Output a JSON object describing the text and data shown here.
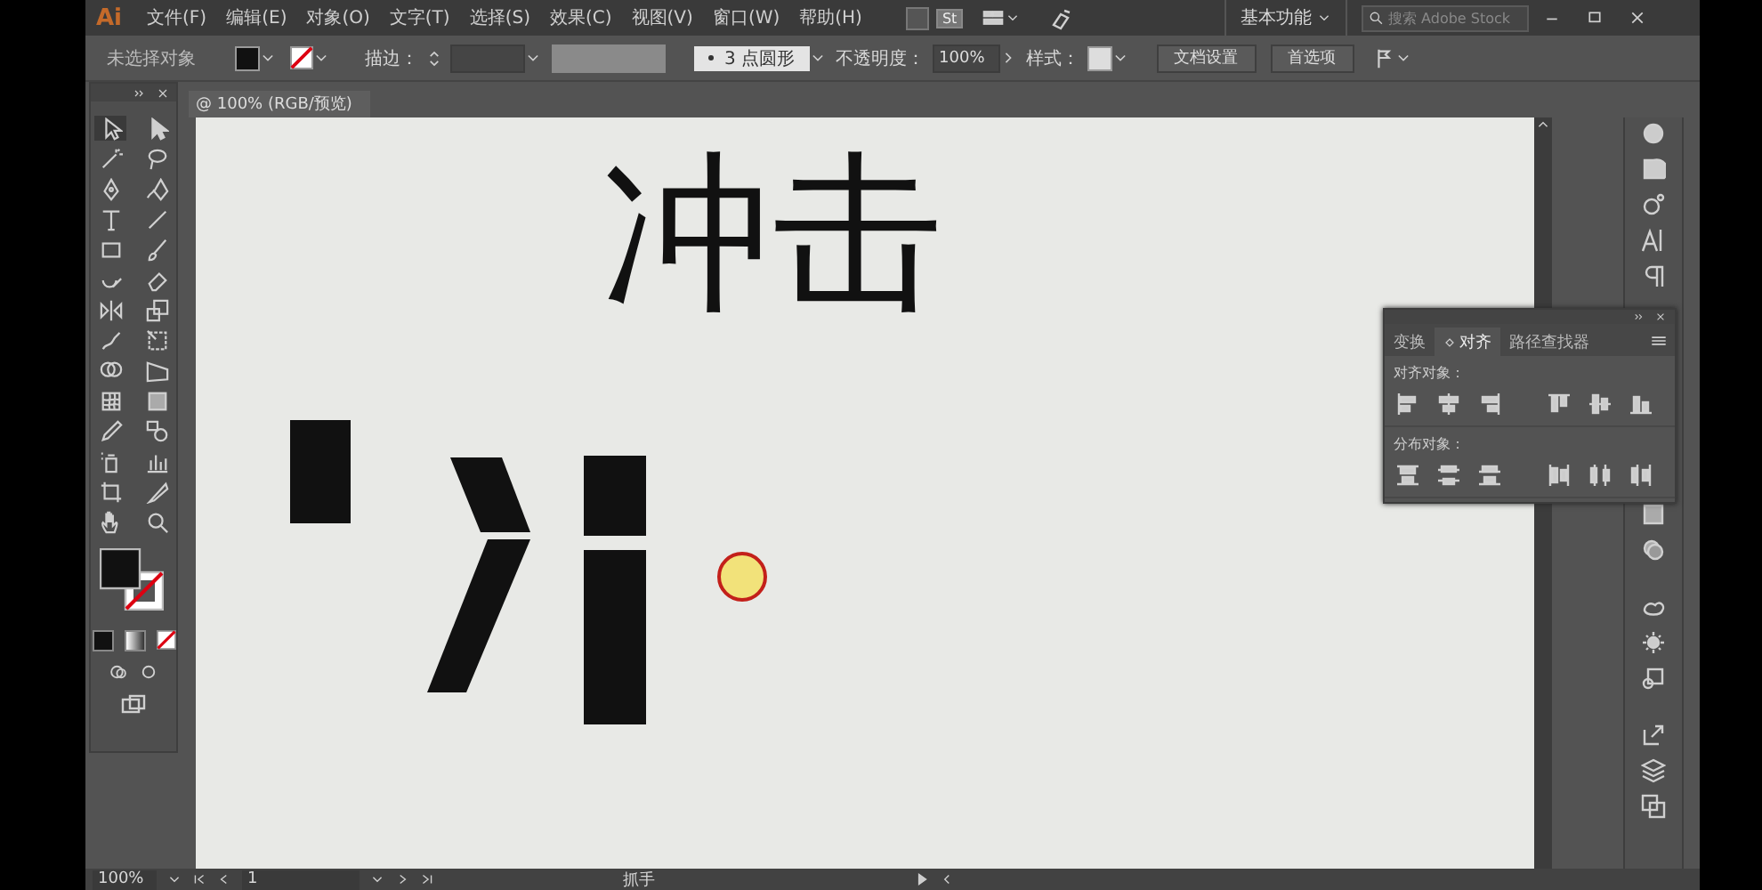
{
  "app": {
    "logo": "Ai",
    "stock_badge": "St"
  },
  "menu": [
    "文件(F)",
    "编辑(E)",
    "对象(O)",
    "文字(T)",
    "选择(S)",
    "效果(C)",
    "视图(V)",
    "窗口(W)",
    "帮助(H)"
  ],
  "workspace": {
    "label": "基本功能"
  },
  "search": {
    "placeholder": "搜索 Adobe Stock"
  },
  "control_bar": {
    "selection": "未选择对象",
    "stroke_label": "描边：",
    "brush": "3 点圆形",
    "opacity_label": "不透明度：",
    "opacity": "100%",
    "style_label": "样式：",
    "buttons": [
      "文档设置",
      "首选项"
    ]
  },
  "document_tab": {
    "title": "@ 100% (RGB/预览)"
  },
  "canvas": {
    "heading": "冲击"
  },
  "align_panel": {
    "tabs": [
      {
        "label": "变换",
        "selected": false
      },
      {
        "label": "对齐",
        "selected": true
      },
      {
        "label": "路径查找器",
        "selected": false
      }
    ],
    "sections": [
      "对齐对象：",
      "分布对象："
    ]
  },
  "status_bar": {
    "zoom": "100%",
    "artboard": "1",
    "tool": "抓手"
  }
}
